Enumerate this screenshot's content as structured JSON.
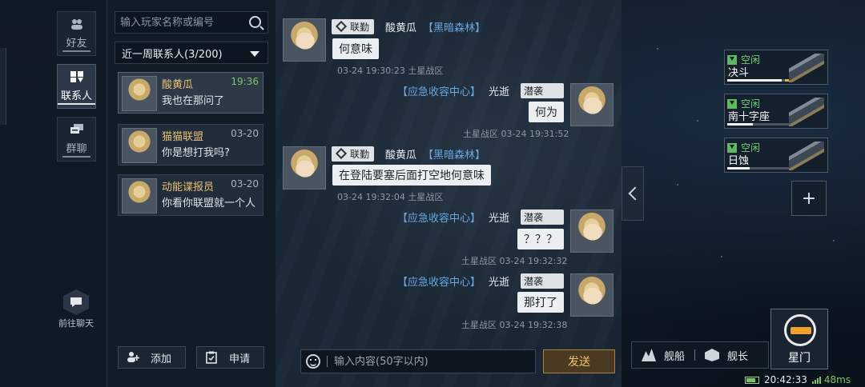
{
  "nav": {
    "tabs": [
      {
        "label": "好友",
        "icon": "friends-icon"
      },
      {
        "label": "联系人",
        "icon": "contacts-icon",
        "active": true
      },
      {
        "label": "群聊",
        "icon": "group-chat-icon"
      }
    ],
    "go_chat_label": "前往聊天"
  },
  "contacts": {
    "search_placeholder": "输入玩家名称或编号",
    "filter_label": "近一周联系人(3/200)",
    "items": [
      {
        "name": "酸黄瓜",
        "time": "19:36",
        "message": "我也在那问了",
        "active": true
      },
      {
        "name": "猫猫联盟",
        "time": "03-20",
        "message": "你是想打我吗?"
      },
      {
        "name": "动能谍报员",
        "time": "03-20",
        "message": "你看你联盟就一个人"
      }
    ],
    "add_label": "添加",
    "apply_label": "申请"
  },
  "chat": {
    "messages": [
      {
        "side": "left",
        "rank": "联勤",
        "name": "酸黄瓜",
        "guild": "【黑暗森林】",
        "text": "何意味",
        "timestamp": "03-24 19:30:23 土星战区"
      },
      {
        "side": "right",
        "guild": "【应急收容中心】",
        "name": "光逝",
        "rank": "潜袭",
        "text": "何为",
        "timestamp": "土星战区 03-24 19:31:52"
      },
      {
        "side": "left",
        "rank": "联勤",
        "name": "酸黄瓜",
        "guild": "【黑暗森林】",
        "text": "在登陆要塞后面打空地何意味",
        "timestamp": "03-24 19:32:04 土星战区"
      },
      {
        "side": "right",
        "guild": "【应急收容中心】",
        "name": "光逝",
        "rank": "潜袭",
        "text": "？？？",
        "timestamp": "土星战区 03-24 19:32:32"
      },
      {
        "side": "right",
        "guild": "【应急收容中心】",
        "name": "光逝",
        "rank": "潜袭",
        "text": "那打了",
        "timestamp": "土星战区 03-24 19:32:38"
      }
    ],
    "input_placeholder": "输入内容(50字以内)",
    "send_label": "发送"
  },
  "fleet": {
    "ships": [
      {
        "status": "空闲",
        "name": "决斗",
        "hp_fraction": 0.85
      },
      {
        "status": "空闲",
        "name": "南十字座",
        "hp_fraction": 0.4
      },
      {
        "status": "空闲",
        "name": "日蚀",
        "hp_fraction": 0.35
      }
    ],
    "add_symbol": "+"
  },
  "dock": {
    "ships_label": "舰船",
    "captain_label": "舰长",
    "stargate_label": "星门"
  },
  "status": {
    "time": "20:42:33",
    "latency": "48ms"
  },
  "colors": {
    "accent_gold": "#f0c36e",
    "guild_blue": "#68a7e0",
    "idle_green": "#74cc77"
  }
}
